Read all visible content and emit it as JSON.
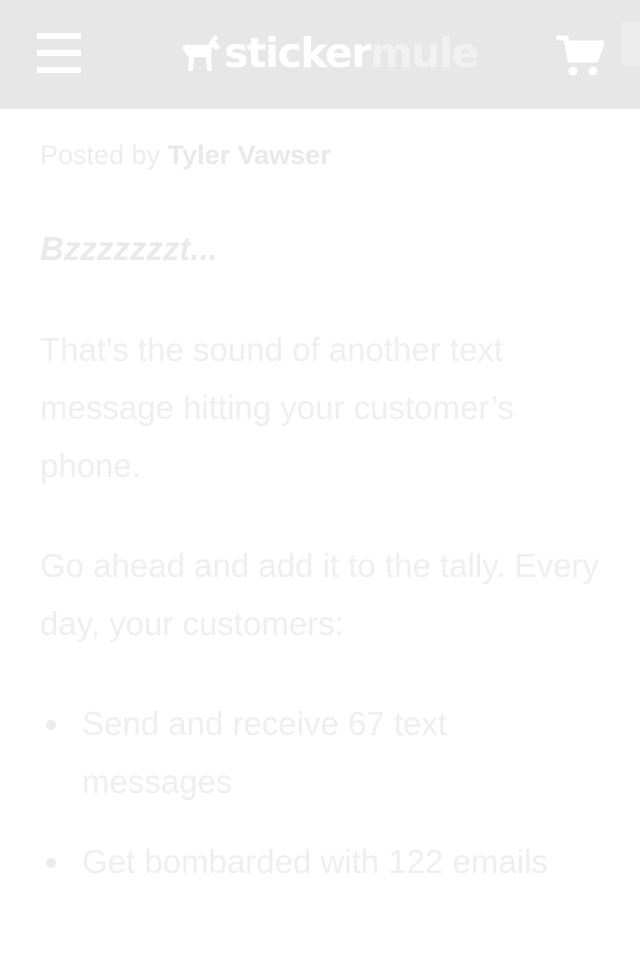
{
  "header": {
    "logo_primary": "sticker",
    "logo_secondary": "mule",
    "menu_icon": "hamburger-menu-icon",
    "cart_icon": "shopping-cart-icon",
    "logo_icon": "mule-logo-icon",
    "background_color": "#e7e7e7"
  },
  "post": {
    "byline_prefix": "Posted by",
    "author": "Tyler Vawser",
    "lead": "Bzzzzzzzt...",
    "paragraphs": [
      "That's the sound of another text message hitting your customer’s phone.",
      "Go ahead and add it to the tally. Every day, your customers:"
    ],
    "list_items": [
      "Send and receive 67 text messages",
      "Get bombarded with 122 emails"
    ]
  }
}
